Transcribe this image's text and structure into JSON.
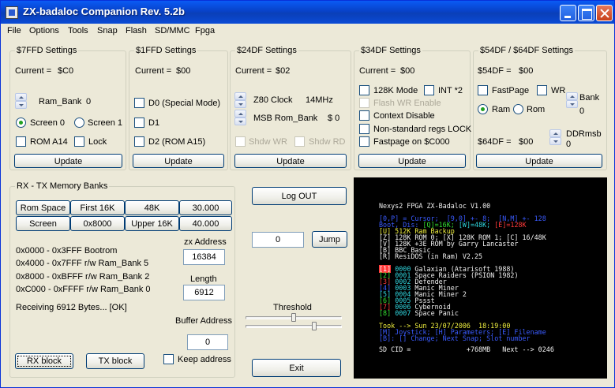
{
  "window": {
    "title": "ZX-badaloc Companion Rev. 5.2b"
  },
  "menu": [
    "File",
    "Options",
    "Tools",
    "Snap",
    "Flash",
    "SD/MMC",
    "Fpga"
  ],
  "g7ffd": {
    "title": "$7FFD Settings",
    "current_label": "Current =",
    "current_value": "$C0",
    "ram_bank_label": "Ram_Bank",
    "ram_bank_value": "0",
    "screen0": "Screen 0",
    "screen1": "Screen 1",
    "rom_a14": "ROM A14",
    "lock": "Lock",
    "update": "Update"
  },
  "g1ffd": {
    "title": "$1FFD Settings",
    "current_label": "Current =",
    "current_value": "$00",
    "d0": "D0 (Special Mode)",
    "d1": "D1",
    "d2": "D2 (ROM A15)",
    "update": "Update"
  },
  "g24df": {
    "title": "$24DF Settings",
    "current_label": "Current =",
    "current_value": "$02",
    "z80_clock_label": "Z80 Clock",
    "z80_clock_value": "14MHz",
    "msb_rom_label": "MSB Rom_Bank",
    "msb_rom_value": "$ 0",
    "shdw_wr": "Shdw WR",
    "shdw_rd": "Shdw RD",
    "update": "Update"
  },
  "g34df": {
    "title": "$34DF Settings",
    "current_label": "Current =",
    "current_value": "$00",
    "mode128k": "128K Mode",
    "int2": "INT *2",
    "flash_wr": "Flash WR Enable",
    "context_disable": "Context Disable",
    "nonstd_lock": "Non-standard regs LOCK",
    "fastpage_c000": "Fastpage on $C000",
    "update": "Update"
  },
  "g54df": {
    "title": "$54DF / $64DF Settings",
    "cur54_label": "$54DF =",
    "cur54_value": "$00",
    "fastpage": "FastPage",
    "wr": "WR",
    "bank_label": "Bank",
    "bank_value": "0",
    "ram": "Ram",
    "rom": "Rom",
    "cur64_label": "$64DF =",
    "cur64_value": "$00",
    "ddrmsb_label": "DDRmsb",
    "ddrmsb_value": "0",
    "update": "Update"
  },
  "rxtx": {
    "title": "RX - TX Memory Banks",
    "buttons_row1": [
      "Rom Space",
      "First 16K",
      "48K",
      "30.000"
    ],
    "buttons_row2": [
      "Screen",
      "0x8000",
      "Upper 16K",
      "40.000"
    ],
    "map_lines": [
      "0x0000 - 0x3FFF Bootrom",
      "0x4000 - 0x7FFF r/w  Ram_Bank 5",
      "0x8000 - 0xBFFF r/w  Ram_Bank 2",
      "0xC000 - 0xFFFF r/w  Ram_Bank 0"
    ],
    "zx_address_label": "zx Address",
    "zx_address_value": "16384",
    "length_label": "Length",
    "length_value": "6912",
    "status": "Receiving 6912 Bytes... [OK]",
    "buffer_address_label": "Buffer Address",
    "buffer_address_value": "0",
    "rx_block": "RX block",
    "tx_block": "TX block",
    "keep_address": "Keep address"
  },
  "controls": {
    "log_out": "Log OUT",
    "jump_value": "0",
    "jump": "Jump",
    "threshold": "Threshold",
    "exit": "Exit"
  },
  "screen": {
    "header": "Nexys2 FPGA ZX-Badaloc V1.00",
    "info_line1": "[0,P] = Cursor;  [9,0] +- 8;  [N,M] +- 128",
    "info_line2a": "Boot, Dis:",
    "info_line2b": "[Q]=16K;",
    "info_line2c": "[W]=48K;",
    "info_line2d": "[E]=128K",
    "menu_lines": [
      "[U] 512K Ram Backup",
      "[Z] 128K ROM 0; [X] 128K ROM 1; [C] 16/48K",
      "[V] 128K +3E ROM by Garry Lancaster",
      "[B] BBC Basic",
      "[R] ResiDOS (in Ram) V2.25"
    ],
    "games": [
      {
        "key": "1",
        "code": "0000",
        "name": "Galaxian (Atarisoft 1988)"
      },
      {
        "key": "2",
        "code": "0001",
        "name": "Space Raiders (PSION 1982)"
      },
      {
        "key": "3",
        "code": "0002",
        "name": "Defender"
      },
      {
        "key": "4",
        "code": "0003",
        "name": "Manic Miner"
      },
      {
        "key": "5",
        "code": "0004",
        "name": "Manic Miner 2"
      },
      {
        "key": "6",
        "code": "0005",
        "name": "Pssst"
      },
      {
        "key": "7",
        "code": "0006",
        "name": "Cybernoid"
      },
      {
        "key": "8",
        "code": "0007",
        "name": "Space Panic"
      }
    ],
    "took": "Took --> Sun 23/07/2006  18:19:00",
    "help1": "[M] Joystick; [H] Parameters; [E] Filename",
    "help2": "[B]: [] Change; Next Snap; Slot number",
    "sd_line": "SD CID =              +768MB   Next --> 0246",
    "colors": {
      "bg": "#000000",
      "blue": "#3a5bff",
      "green": "#33e033",
      "red": "#ff3a3a",
      "yellow": "#f0f040",
      "cyan": "#30d8e0"
    }
  }
}
